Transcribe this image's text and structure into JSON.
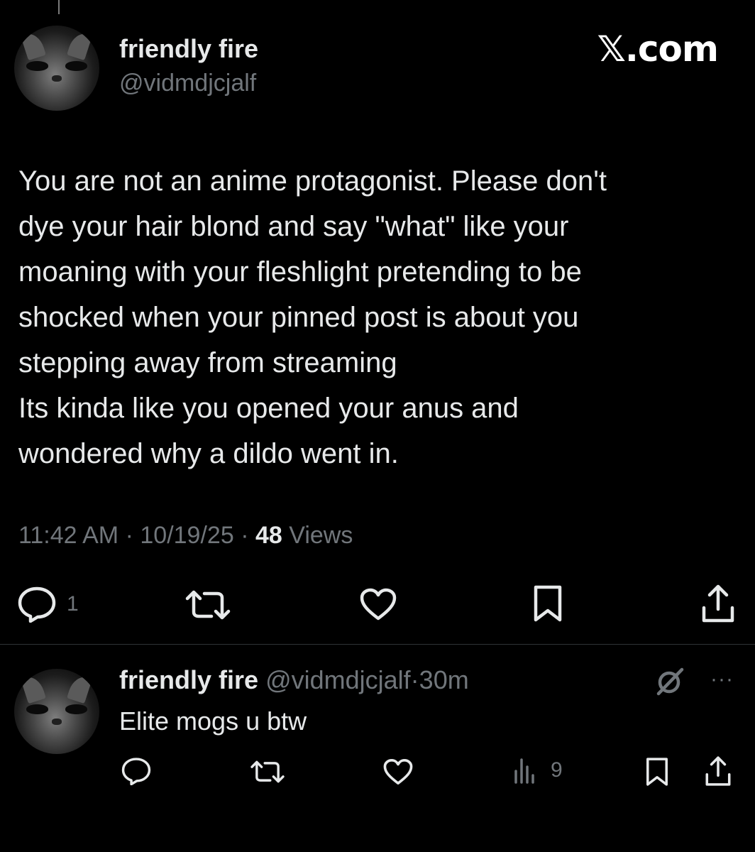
{
  "tweet": {
    "author_name": "friendly fire",
    "author_handle": "@vidmdjcjalf",
    "brand": "𝕏.com",
    "text": "You are not an anime protagonist. Please don't\ndye your hair blond and say \"what\" like your\nmoaning with your fleshlight pretending to be\nshocked when your pinned post is about you\nstepping away from streaming\nIts kinda like you opened your anus and\nwondered why a dildo went in.",
    "time": "11:42 AM",
    "date": "10/19/25",
    "views_count": "48",
    "views_label": "Views",
    "sep": "·",
    "reply_count": "1"
  },
  "reply": {
    "author_name": "friendly fire",
    "author_handle": "@vidmdjcjalf",
    "sep": "·",
    "time": "30m",
    "text": "Elite mogs u btw",
    "views_count": "9",
    "more": "···"
  },
  "icons": {
    "reply": "comment-icon",
    "retweet": "retweet-icon",
    "like": "heart-icon",
    "bookmark": "bookmark-icon",
    "share": "share-icon",
    "views": "analytics-icon",
    "grok": "grok-icon"
  },
  "colors": {
    "background": "#000000",
    "text": "#e7e9ea",
    "secondary": "#71767b",
    "divider": "#2f3336"
  }
}
